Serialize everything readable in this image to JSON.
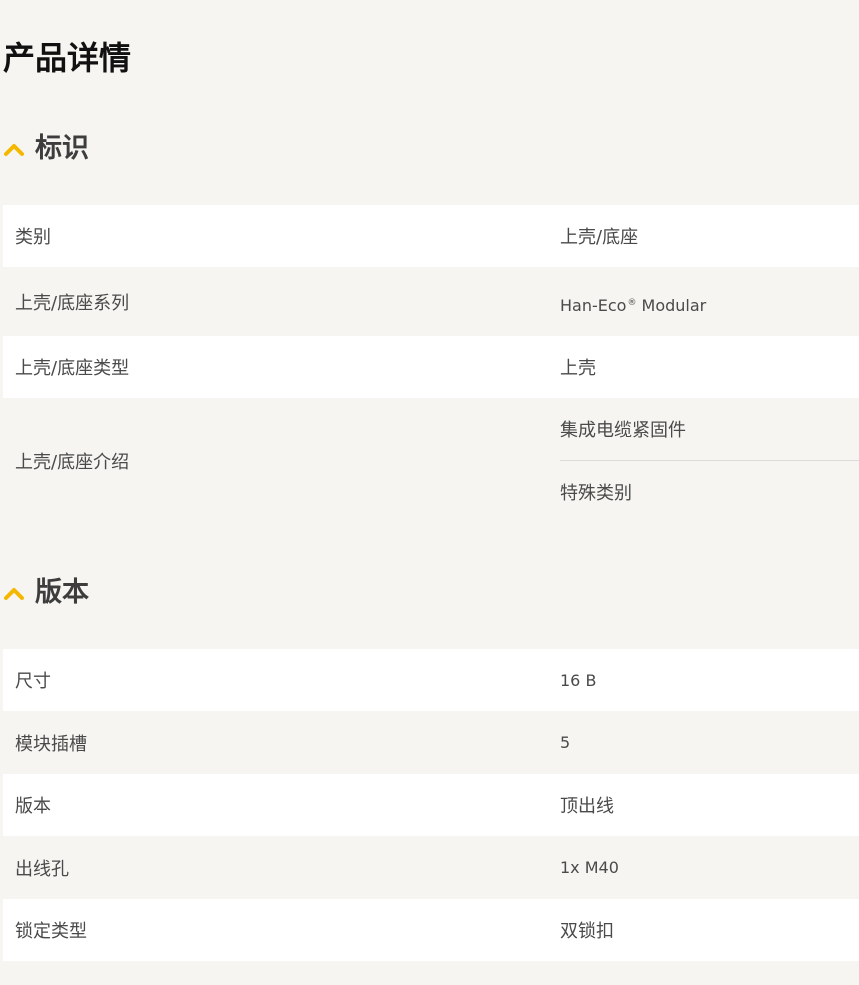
{
  "page_title": "产品详情",
  "accent_color": "#f5b800",
  "sections": [
    {
      "title": "标识",
      "rows": [
        {
          "key": "类别",
          "value": "上壳/底座"
        },
        {
          "key": "上壳/底座系列",
          "value": "Han-Eco",
          "value_sup": "®",
          "value_suffix": " Modular"
        },
        {
          "key": "上壳/底座类型",
          "value": "上壳"
        },
        {
          "key": "上壳/底座介绍",
          "values": [
            "集成电缆紧固件",
            "特殊类别"
          ]
        }
      ]
    },
    {
      "title": "版本",
      "rows": [
        {
          "key": "尺寸",
          "value": "16 B"
        },
        {
          "key": "模块插槽",
          "value": "5"
        },
        {
          "key": "版本",
          "value": "顶出线"
        },
        {
          "key": "出线孔",
          "value": "1x M40"
        },
        {
          "key": "锁定类型",
          "value": "双锁扣"
        }
      ]
    }
  ]
}
